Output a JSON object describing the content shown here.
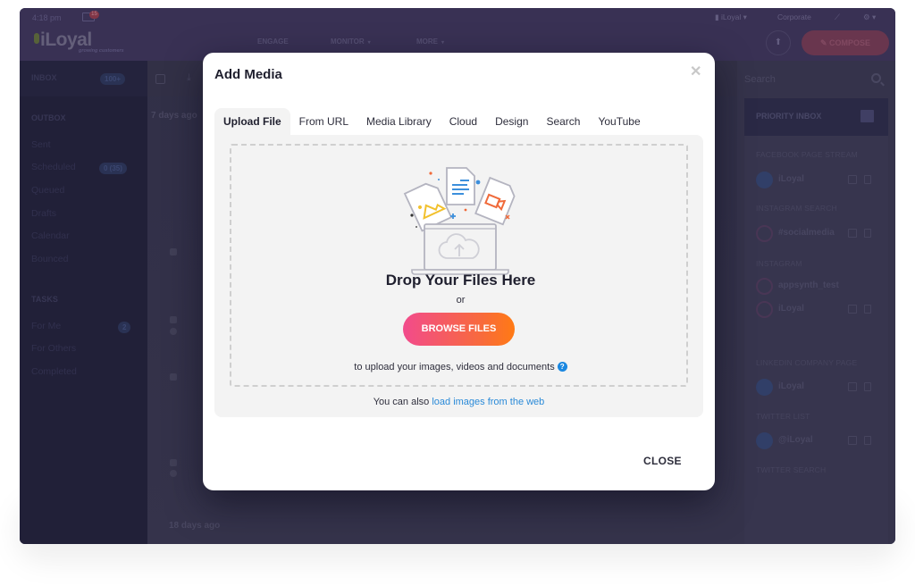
{
  "topbar": {
    "time": "4:18 pm",
    "mail_badge": "15",
    "logo": "iLoyal",
    "tagline": "growing customers",
    "nav": [
      "ENGAGE",
      "MONITOR",
      "MORE"
    ],
    "account": "iLoyal",
    "workspace": "Corporate",
    "compose_label": "COMPOSE"
  },
  "sidebar": {
    "inbox_label": "INBOX",
    "inbox_badge": "100+",
    "outbox_label": "OUTBOX",
    "outbox_items": [
      {
        "label": "Sent"
      },
      {
        "label": "Scheduled",
        "badge": "0 (35)"
      },
      {
        "label": "Queued"
      },
      {
        "label": "Drafts"
      },
      {
        "label": "Calendar"
      },
      {
        "label": "Bounced"
      }
    ],
    "tasks_label": "TASKS",
    "task_items": [
      {
        "label": "For Me",
        "badge": "2"
      },
      {
        "label": "For Others"
      },
      {
        "label": "Completed"
      }
    ]
  },
  "main": {
    "group_labels": [
      "7 days ago",
      "18 days ago"
    ]
  },
  "right_panel": {
    "search_placeholder": "Search",
    "priority_label": "PRIORITY INBOX",
    "streams": [
      {
        "heading": "FACEBOOK PAGE STREAM",
        "accounts": [
          {
            "name": "iLoyal",
            "type": "facebook"
          }
        ]
      },
      {
        "heading": "INSTAGRAM SEARCH",
        "accounts": [
          {
            "name": "#socialmedia",
            "type": "instagram"
          }
        ]
      },
      {
        "heading": "INSTAGRAM",
        "accounts": [
          {
            "name": "appsynth_test",
            "type": "instagram"
          },
          {
            "name": "iLoyal",
            "type": "instagram"
          }
        ]
      },
      {
        "heading": "LINKEDIN COMPANY PAGE",
        "accounts": [
          {
            "name": "iLoyal",
            "type": "linkedin"
          }
        ]
      },
      {
        "heading": "TWITTER LIST",
        "accounts": [
          {
            "name": "@iLoyal",
            "type": "twitter"
          }
        ]
      },
      {
        "heading": "TWITTER SEARCH",
        "accounts": []
      }
    ]
  },
  "modal": {
    "title": "Add Media",
    "tabs": [
      "Upload File",
      "From URL",
      "Media Library",
      "Cloud",
      "Design",
      "Search",
      "YouTube"
    ],
    "active_tab": "Upload File",
    "drop_title": "Drop Your Files Here",
    "or_text": "or",
    "browse_label": "BROWSE FILES",
    "hint": "to upload your images, videos and documents",
    "also_prefix": "You can also",
    "also_link": "load images from the web",
    "close_label": "CLOSE",
    "colors": {
      "browse_gradient_start": "#f24b8c",
      "browse_gradient_end": "#ff7a14",
      "link": "#2a8ad8",
      "help_icon": "#1a87e0"
    }
  }
}
